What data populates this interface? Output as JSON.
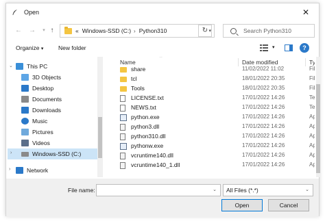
{
  "window": {
    "title": "Open"
  },
  "address": {
    "crumbs": [
      "Windows-SSD (C:)",
      "Python310"
    ],
    "prefix": "«"
  },
  "search": {
    "placeholder": "Search Python310"
  },
  "toolbar": {
    "organize_label": "Organize",
    "new_folder_label": "New folder"
  },
  "nav": {
    "items": [
      {
        "label": "This PC",
        "icon": "monitor-icon",
        "color": "#3a8fd8"
      },
      {
        "label": "3D Objects",
        "icon": "cube-icon",
        "color": "#5ea6e6"
      },
      {
        "label": "Desktop",
        "icon": "desktop-icon",
        "color": "#2b79c9"
      },
      {
        "label": "Documents",
        "icon": "documents-icon",
        "color": "#8a8a8a"
      },
      {
        "label": "Downloads",
        "icon": "download-icon",
        "color": "#2b79c9"
      },
      {
        "label": "Music",
        "icon": "music-icon",
        "color": "#2b79c9"
      },
      {
        "label": "Pictures",
        "icon": "pictures-icon",
        "color": "#6fa9dc"
      },
      {
        "label": "Videos",
        "icon": "videos-icon",
        "color": "#5a6e8a"
      },
      {
        "label": "Windows-SSD (C:)",
        "icon": "drive-icon",
        "color": "#8a8a8a"
      },
      {
        "label": "Network",
        "icon": "network-icon",
        "color": "#2b79c9"
      }
    ]
  },
  "columns": {
    "name": "Name",
    "date": "Date modified",
    "type": "Ty"
  },
  "files": [
    {
      "name": "share",
      "date": "11/02/2022 11:02",
      "type": "Fil",
      "kind": "folder"
    },
    {
      "name": "tcl",
      "date": "18/01/2022 20:35",
      "type": "Fil",
      "kind": "folder"
    },
    {
      "name": "Tools",
      "date": "18/01/2022 20:35",
      "type": "Fil",
      "kind": "folder"
    },
    {
      "name": "LICENSE.txt",
      "date": "17/01/2022 14:26",
      "type": "Te",
      "kind": "doc"
    },
    {
      "name": "NEWS.txt",
      "date": "17/01/2022 14:26",
      "type": "Te",
      "kind": "doc"
    },
    {
      "name": "python.exe",
      "date": "17/01/2022 14:26",
      "type": "Ap",
      "kind": "exe"
    },
    {
      "name": "python3.dll",
      "date": "17/01/2022 14:26",
      "type": "Ap",
      "kind": "dll"
    },
    {
      "name": "python310.dll",
      "date": "17/01/2022 14:26",
      "type": "Ap",
      "kind": "dll"
    },
    {
      "name": "pythonw.exe",
      "date": "17/01/2022 14:26",
      "type": "Ap",
      "kind": "exe"
    },
    {
      "name": "vcruntime140.dll",
      "date": "17/01/2022 14:26",
      "type": "Ap",
      "kind": "dll"
    },
    {
      "name": "vcruntime140_1.dll",
      "date": "17/01/2022 14:26",
      "type": "Ap",
      "kind": "dll"
    }
  ],
  "bottom": {
    "file_name_label": "File name:",
    "file_name_value": "",
    "file_type_value": "All Files (*.*)",
    "open_label": "Open",
    "cancel_label": "Cancel"
  }
}
